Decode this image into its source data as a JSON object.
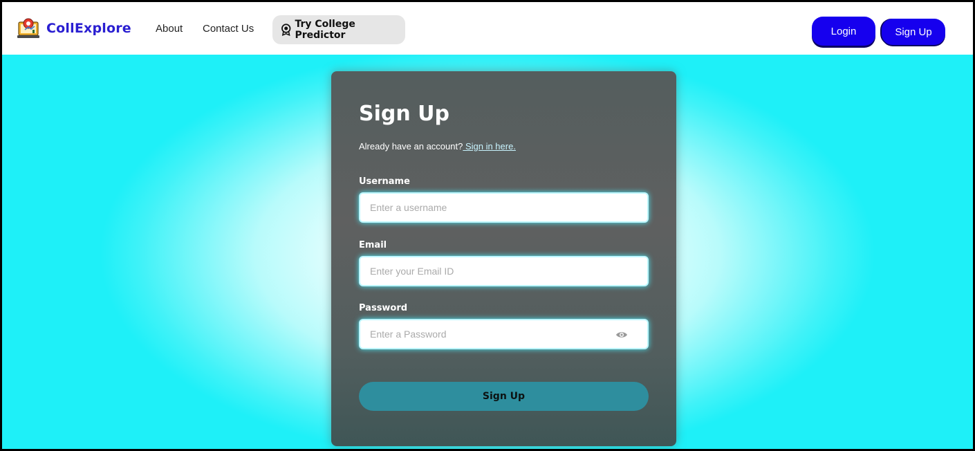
{
  "brand": {
    "name": "CollExplore",
    "logo_icon": "laptop-pin-icon"
  },
  "nav": {
    "about": "About",
    "contact": "Contact Us",
    "predictor": {
      "label": "Try College Predictor",
      "icon": "award-badge-icon"
    }
  },
  "auth": {
    "login": "Login",
    "signup": "Sign Up"
  },
  "form": {
    "title": "Sign Up",
    "subtitle_text": "Already have an account?",
    "subtitle_link": " Sign in here.",
    "username": {
      "label": "Username",
      "placeholder": "Enter a username"
    },
    "email": {
      "label": "Email",
      "placeholder": "Enter your Email ID"
    },
    "password": {
      "label": "Password",
      "placeholder": "Enter a Password",
      "toggle_icon": "eye-icon"
    },
    "submit": "Sign Up"
  },
  "colors": {
    "brand_blue": "#2a1fd1",
    "button_blue": "#1600ee",
    "cyan_bg": "#1ef0f8",
    "card_gray": "#5f6060",
    "submit_teal": "#2e8e9e"
  }
}
